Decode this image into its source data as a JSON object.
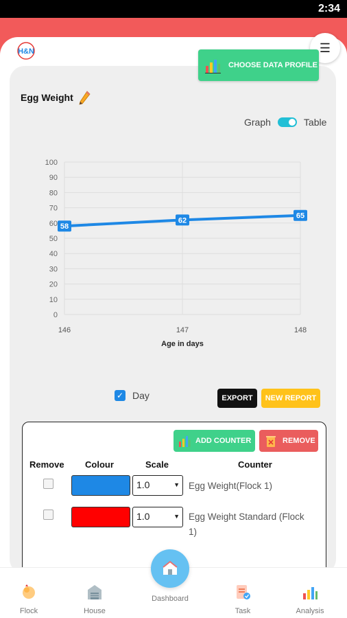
{
  "status_bar": {
    "time": "2:34"
  },
  "header": {
    "logo_text": "H&N",
    "choose_profile_label": "CHOOSE DATA PROFILE"
  },
  "page": {
    "title": "Egg Weight"
  },
  "view_toggle": {
    "left_label": "Graph",
    "right_label": "Table"
  },
  "chart_data": {
    "type": "line",
    "x": [
      146,
      147,
      148
    ],
    "series": [
      {
        "values": [
          58,
          62,
          65
        ],
        "color": "#1e88e5"
      }
    ],
    "xlabel": "Age in days",
    "ylabel": "",
    "xlim": [
      146,
      148
    ],
    "ylim": [
      0,
      100
    ],
    "y_ticks": [
      0,
      10,
      20,
      30,
      40,
      50,
      60,
      70,
      80,
      90,
      100
    ],
    "grid": true,
    "data_labels": true
  },
  "controls": {
    "day_label": "Day",
    "day_checked": true,
    "export_label": "EXPORT",
    "new_report_label": "NEW REPORT"
  },
  "counter_panel": {
    "add_counter_label": "ADD COUNTER",
    "remove_label": "REMOVE",
    "headers": {
      "remove": "Remove",
      "colour": "Colour",
      "scale": "Scale",
      "counter": "Counter"
    },
    "rows": [
      {
        "color": "#1e88e5",
        "scale": "1.0",
        "counter_line1": "Egg Weight(Flock 1)",
        "counter_line2": ""
      },
      {
        "color": "#ff0000",
        "scale": "1.0",
        "counter_line1": "Egg Weight Standard (Flock",
        "counter_line2": "1)"
      }
    ]
  },
  "bottom_nav": {
    "flock": "Flock",
    "house": "House",
    "dashboard": "Dashboard",
    "task": "Task",
    "analysis": "Analysis"
  }
}
